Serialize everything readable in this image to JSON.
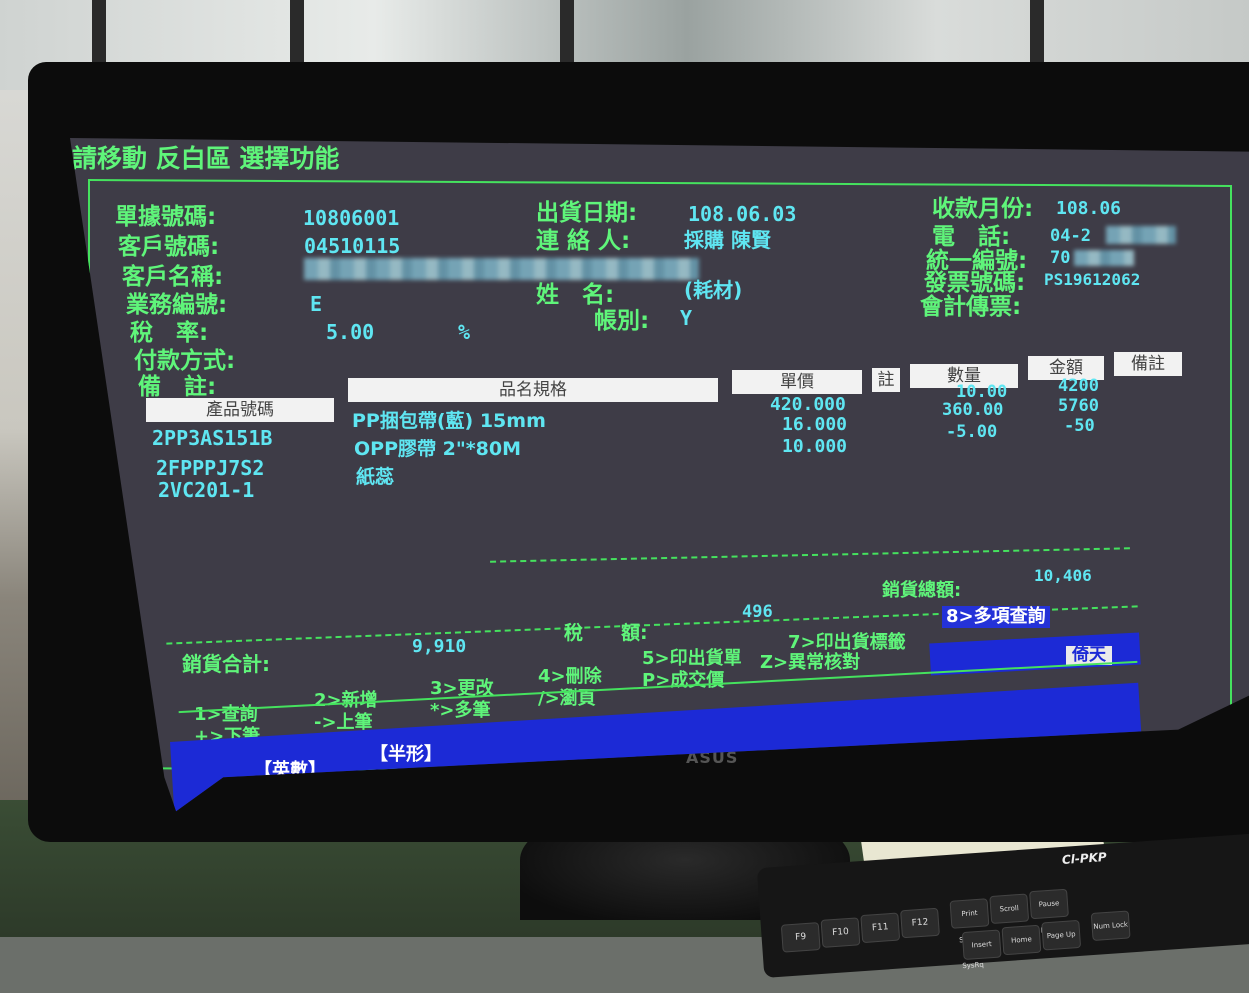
{
  "screen": {
    "instruction": "請移動 反白區 選擇功能",
    "header": {
      "doc_no_label": "單據號碼:",
      "doc_no": "10806001",
      "customer_no_label": "客戶號碼:",
      "customer_no": "04510115",
      "customer_name_label": "客戶名稱:",
      "sales_no_label": "業務編號:",
      "sales_no": "E",
      "tax_rate_label": "稅　率:",
      "tax_rate": "5.00",
      "tax_rate_unit": "%",
      "payment_label": "付款方式:",
      "remarks_label": "備　註:",
      "ship_date_label": "出貨日期:",
      "ship_date": "108.06.03",
      "contact_label": "連 絡 人:",
      "contact": "採購 陳賢",
      "name_label": "姓　名:",
      "name": "(耗材)",
      "account_label": "帳別:",
      "account": "Y",
      "collect_month_label": "收款月份:",
      "collect_month": "108.06",
      "phone_label": "電　話:",
      "phone": "04-2",
      "tax_id_label": "統一編號:",
      "tax_id": "70",
      "invoice_no_label": "發票號碼:",
      "invoice_no": "PS19612062",
      "accounting_label": "會計傳票:"
    },
    "table": {
      "columns": [
        "產品號碼",
        "品名規格",
        "單價",
        "註",
        "數量",
        "金額",
        "備註"
      ],
      "rows": [
        {
          "code": "2PP3AS151B",
          "spec": "PP捆包帶(藍)  15mm",
          "price": "420.000",
          "qty": "10.00",
          "amount": "4200"
        },
        {
          "code": "2FPPPJ7S2",
          "spec": "OPP膠帶 2\"*80M",
          "price": "16.000",
          "qty": "360.00",
          "amount": "5760"
        },
        {
          "code": "2VC201-1",
          "spec": "紙蕊",
          "price": "10.000",
          "qty": "-5.00",
          "amount": "-50"
        }
      ]
    },
    "totals": {
      "sales_total_amount_label": "銷貨總額:",
      "sales_total_amount": "10,406",
      "tax_label": "稅　　額:",
      "tax": "496",
      "sales_subtotal_label": "銷貨合計:",
      "sales_subtotal": "9,910"
    },
    "menu": {
      "query": "1>查詢",
      "add": "2>新增",
      "edit": "3>更改",
      "delete": "4>刪除",
      "print_bill": "5>印出貨單",
      "print_label": "7>印出貨標籤",
      "multi_query": "8>多項查詢",
      "next": "+>下筆",
      "prev": "->上筆",
      "multi": "*>多筆",
      "browse": "/>瀏頁",
      "deal_price": "P>成交價",
      "anomaly": "Z>異常核對",
      "badge": "倚天"
    },
    "status": {
      "input_mode": "【英數】",
      "width_mode": "【半形】"
    }
  },
  "hardware": {
    "monitor_brand": "ASUS",
    "keyboard_brand": "Cl-PKP",
    "keys": [
      "F9",
      "F10",
      "F11",
      "F12",
      "Print Screen SysRq",
      "Scroll Lock",
      "Pause Break",
      "Insert",
      "Home",
      "Page Up",
      "Num Lock"
    ]
  }
}
